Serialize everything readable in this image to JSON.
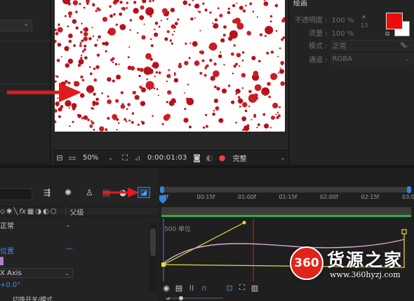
{
  "viewer": {
    "zoom_level": "50%",
    "timecode": "0:00:01:03",
    "resolution": "完整"
  },
  "paint_panel": {
    "title": "绘画",
    "opacity_label": "不透明度 :",
    "opacity_value": "100 %",
    "flow_label": "流量 :",
    "flow_value": "100 %",
    "mode_label": "模式 :",
    "mode_value": "正常",
    "channel_label": "通道 :",
    "channel_value": "RGBA",
    "brush_size": "13",
    "foreground_color": "#f00b0b",
    "background_color": "#ffffff"
  },
  "timeline": {
    "parent_header": "父级",
    "blend_mode": "正常",
    "position_label": "位置",
    "axis_dropdown": "X Axis",
    "offset_value": "+0.0°",
    "switch_modes": "切换开关/模式",
    "graph_unit": "500 单位",
    "ruler_ticks": [
      "0f",
      "00:15f",
      "01:00f",
      "01:15f",
      "02:00f",
      "02:15f",
      "03:0"
    ]
  },
  "watermark": {
    "badge": "360",
    "name": "货源之家",
    "url": "www.360hyzj.com"
  },
  "colors": {
    "annotation_arrow": "#e01b1b",
    "accent_blue": "#3b82e0",
    "work_area_green": "#27b33d",
    "speed_curve": "#d9a8d8",
    "value_curve": "#e6db3a",
    "current_time_line": "#d01f1f"
  }
}
